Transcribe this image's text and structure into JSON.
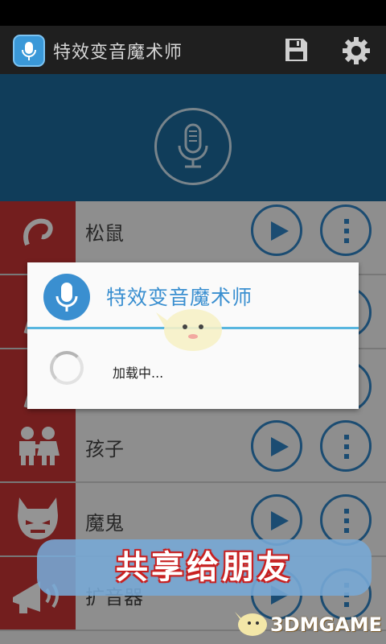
{
  "app": {
    "title": "特效变音魔术师"
  },
  "actions": {
    "save_icon": "save-icon",
    "settings_icon": "gear-icon"
  },
  "list": {
    "items": [
      {
        "label": "松鼠",
        "thumb_icon": "squirrel-icon"
      },
      {
        "label": "",
        "thumb_icon": "figure-icon"
      },
      {
        "label": "",
        "thumb_icon": "figure-icon"
      },
      {
        "label": "孩子",
        "thumb_icon": "children-icon"
      },
      {
        "label": "魔鬼",
        "thumb_icon": "devil-icon"
      },
      {
        "label": "扩音器",
        "thumb_icon": "megaphone-icon"
      }
    ]
  },
  "dialog": {
    "title": "特效变音魔术师",
    "message": "加载中..."
  },
  "banner": {
    "text": "共享给朋友"
  },
  "watermark": {
    "text": "3DMGAME"
  },
  "colors": {
    "accent": "#2f83c5",
    "header": "#1d6a9b",
    "thumb": "#c73434",
    "divider": "#58b6df"
  }
}
